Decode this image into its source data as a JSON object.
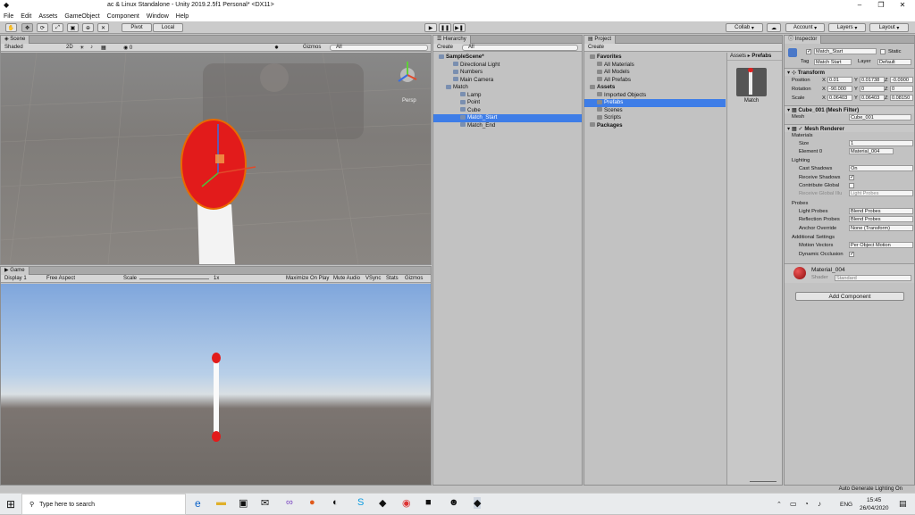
{
  "window": {
    "title": "ac & Linux Standalone - Unity 2019.2.5f1 Personal* <DX11>"
  },
  "menu": [
    "File",
    "Edit",
    "Assets",
    "GameObject",
    "Component",
    "Window",
    "Help"
  ],
  "toolbar": {
    "pivot": "Pivot",
    "local": "Local",
    "collab": "Collab",
    "account": "Account",
    "layers": "Layers",
    "layout": "Layout"
  },
  "scene": {
    "tab": "Scene",
    "shading": "Shaded",
    "mode2d": "2D",
    "gizmos": "Gizmos",
    "search": "All",
    "persp": "Persp"
  },
  "game": {
    "tab": "Game",
    "display": "Display 1",
    "aspect": "Free Aspect",
    "scale_label": "Scale",
    "scale_value": "1x",
    "max": "Maximize On Play",
    "mute": "Mute Audio",
    "vsync": "VSync",
    "stats": "Stats",
    "gizmos": "Gizmos"
  },
  "hierarchy": {
    "tab": "Hierarchy",
    "create": "Create",
    "search": "All",
    "items": [
      {
        "label": "SampleScene*",
        "indent": 0,
        "bold": true
      },
      {
        "label": "Directional Light",
        "indent": 2
      },
      {
        "label": "Numbers",
        "indent": 2
      },
      {
        "label": "Main Camera",
        "indent": 2
      },
      {
        "label": "Match",
        "indent": 1
      },
      {
        "label": "Lamp",
        "indent": 3
      },
      {
        "label": "Point",
        "indent": 3
      },
      {
        "label": "Cube",
        "indent": 3
      },
      {
        "label": "Match_Start",
        "indent": 3,
        "selected": true
      },
      {
        "label": "Match_End",
        "indent": 3
      }
    ]
  },
  "project": {
    "tab": "Project",
    "create": "Create",
    "tree": [
      {
        "label": "Favorites",
        "indent": 0,
        "bold": true
      },
      {
        "label": "All Materials",
        "indent": 1
      },
      {
        "label": "All Models",
        "indent": 1
      },
      {
        "label": "All Prefabs",
        "indent": 1
      },
      {
        "label": "Assets",
        "indent": 0,
        "bold": true
      },
      {
        "label": "Imported Objects",
        "indent": 1
      },
      {
        "label": "Prefabs",
        "indent": 1,
        "selected": true
      },
      {
        "label": "Scenes",
        "indent": 1
      },
      {
        "label": "Scripts",
        "indent": 1
      },
      {
        "label": "Packages",
        "indent": 0,
        "bold": true
      }
    ],
    "breadcrumb_root": "Assets",
    "breadcrumb_leaf": "Prefabs",
    "asset_name": "Match"
  },
  "inspector": {
    "tab": "Inspector",
    "object_name": "Match_Start",
    "static": "Static",
    "tag_label": "Tag",
    "tag": "Match Start",
    "layer_label": "Layer",
    "layer": "Default",
    "transform": {
      "title": "Transform",
      "rows": [
        {
          "label": "Position",
          "x": "0.01",
          "y": "0.01738",
          "z": "-0.0900"
        },
        {
          "label": "Rotation",
          "x": "-90.000",
          "y": "0",
          "z": "0"
        },
        {
          "label": "Scale",
          "x": "0.06403",
          "y": "0.06403",
          "z": "0.08150"
        }
      ]
    },
    "mesh_filter": {
      "title": "Cube_001 (Mesh Filter)",
      "mesh_label": "Mesh",
      "mesh": "Cube_001"
    },
    "renderer": {
      "title": "Mesh Renderer",
      "materials": "Materials",
      "size_label": "Size",
      "size": "1",
      "element_label": "Element 0",
      "element": "Material_004",
      "lighting": "Lighting",
      "cast_label": "Cast Shadows",
      "cast": "On",
      "receive_label": "Receive Shadows",
      "contribute_label": "Contribute Global",
      "receive_gi_label": "Receive Global Illu",
      "receive_gi": "Light Probes",
      "probes": "Probes",
      "light_probes_label": "Light Probes",
      "light_probes": "Blend Probes",
      "reflection_label": "Reflection Probes",
      "reflection": "Blend Probes",
      "anchor_label": "Anchor Override",
      "anchor": "None (Transform)",
      "additional": "Additional Settings",
      "motion_label": "Motion Vectors",
      "motion": "Per Object Motion",
      "occlusion_label": "Dynamic Occlusion"
    },
    "material": {
      "name": "Material_004",
      "shader_label": "Shader",
      "shader": "Standard"
    },
    "add_component": "Add Component"
  },
  "status": {
    "text": "Auto Generate Lighting On"
  },
  "taskbar": {
    "search": "Type here to search",
    "lang": "ENG",
    "time": "15:45",
    "date": "26/04/2020"
  },
  "colors": {
    "selection": "#3e7de7",
    "match_head": "#e21b1b",
    "sky": "#9fbde6"
  }
}
